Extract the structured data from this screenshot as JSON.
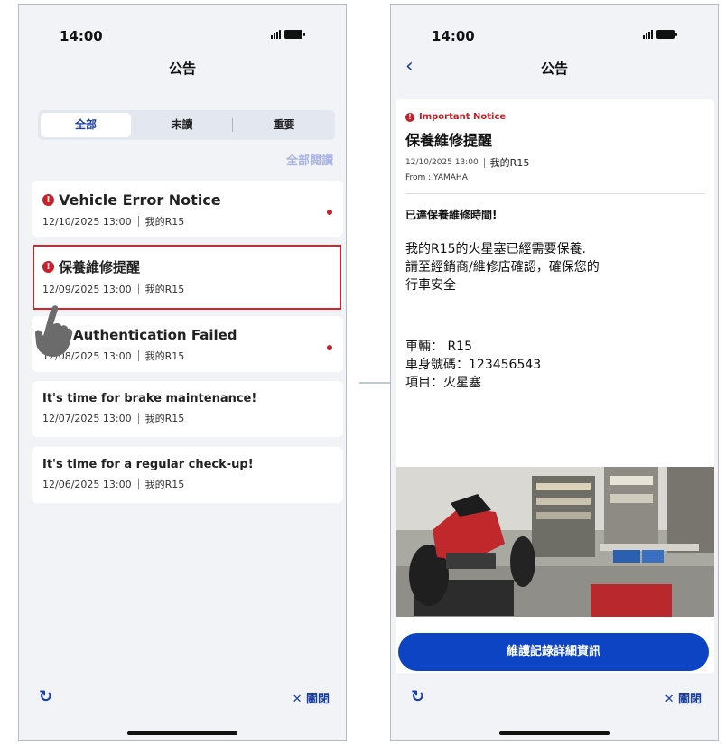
{
  "list_screen": {
    "status_time": "14:00",
    "nav_title": "公告",
    "tabs": [
      {
        "label": "全部",
        "active": true
      },
      {
        "label": "未讀",
        "active": false
      },
      {
        "label": "重要",
        "active": false
      }
    ],
    "mark_all_read": "全部閱讀",
    "notices": [
      {
        "title": "Vehicle Error Notice",
        "date": "12/10/2025 13:00",
        "vehicle": "我的R15",
        "important": true,
        "unread": true
      },
      {
        "title": "保養維修提醒",
        "date": "12/09/2025 13:00",
        "vehicle": "我的R15",
        "important": true,
        "unread": false,
        "highlighted": true
      },
      {
        "title": "Authentication Failed",
        "date": "12/08/2025 13:00",
        "vehicle": "我的R15",
        "important": false,
        "unread": true
      },
      {
        "title": "It's time for brake maintenance!",
        "date": "12/07/2025 13:00",
        "vehicle": "我的R15",
        "important": false,
        "unread": false
      },
      {
        "title": "It's time for a regular check-up!",
        "date": "12/06/2025 13:00",
        "vehicle": "我的R15",
        "important": false,
        "unread": false
      }
    ],
    "refresh_icon": "refresh-icon",
    "close_label": "✕ 關閉"
  },
  "detail_screen": {
    "status_time": "14:00",
    "nav_title": "公告",
    "important_label": "Important Notice",
    "title": "保養維修提醒",
    "date": "12/10/2025 13:00",
    "vehicle": "我的R15",
    "from": "From : YAMAHA",
    "heading": "已達保養維修時間!",
    "body_lines": [
      "我的R15的火星塞已經需要保養.",
      "請至經銷商/維修店確認，確保您的",
      "行車安全"
    ],
    "specs": [
      "車輛： R15",
      "車身號碼：123456543",
      "項目：火星塞"
    ],
    "button_label": "維護記錄詳細資訊",
    "close_label": "✕ 關閉"
  },
  "colors": {
    "accent": "#1a3fa3",
    "button": "#0d44c4",
    "alert": "#c8202b",
    "highlight": "#d8232a",
    "mark_all": "#a9b4e8"
  }
}
